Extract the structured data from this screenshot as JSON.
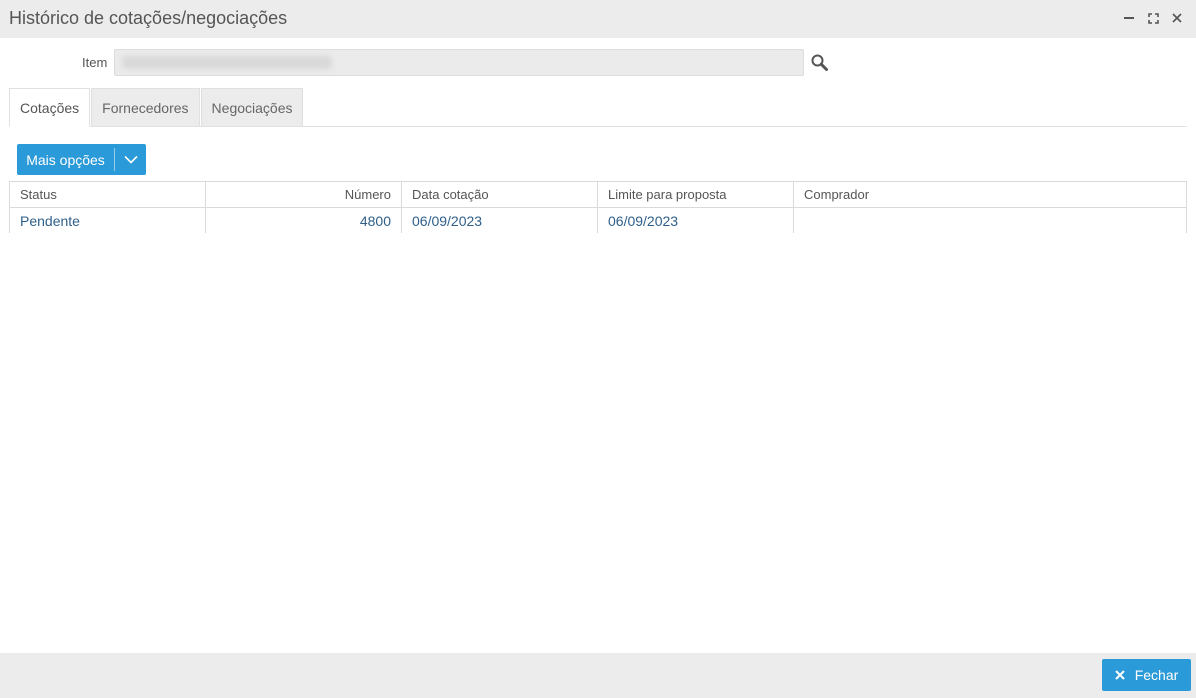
{
  "window": {
    "title": "Histórico de cotações/negociações"
  },
  "item": {
    "label": "Item",
    "value": ""
  },
  "tabs": [
    {
      "label": "Cotações",
      "active": true
    },
    {
      "label": "Fornecedores",
      "active": false
    },
    {
      "label": "Negociações",
      "active": false
    }
  ],
  "toolbar": {
    "more_options_label": "Mais opções"
  },
  "table": {
    "columns": [
      "Status",
      "Número",
      "Data cotação",
      "Limite para proposta",
      "Comprador"
    ],
    "rows": [
      {
        "status": "Pendente",
        "numero": "4800",
        "data_cotacao": "06/09/2023",
        "limite": "06/09/2023",
        "comprador": ""
      }
    ]
  },
  "footer": {
    "close_label": "Fechar"
  },
  "colors": {
    "accent": "#2b9ad8",
    "title_bar": "#ececec",
    "link_text": "#2f5f8a"
  }
}
